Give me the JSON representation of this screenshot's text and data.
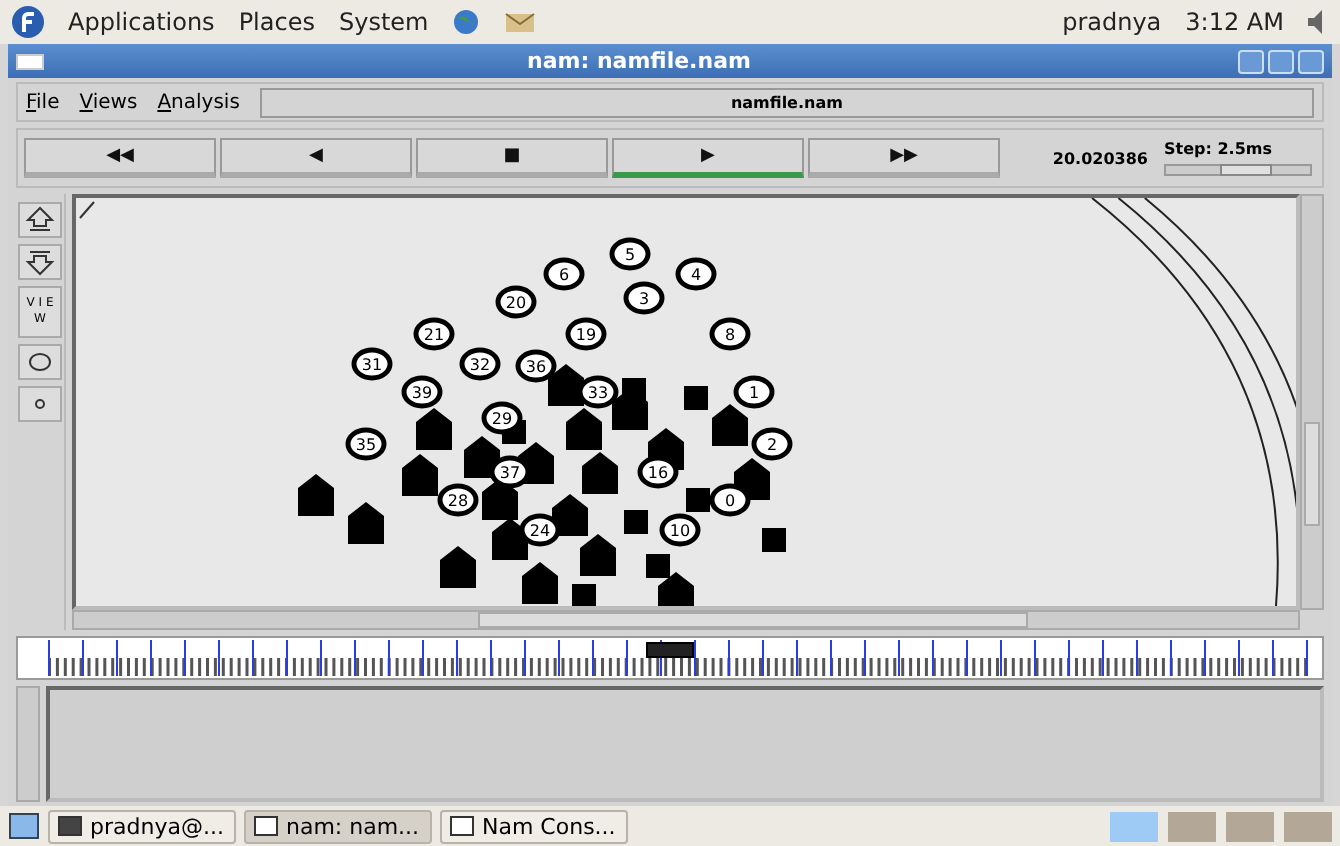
{
  "top_panel": {
    "menus": [
      "Applications",
      "Places",
      "System"
    ],
    "user": "pradnya",
    "clock": "3:12 AM"
  },
  "window": {
    "title": "nam: namfile.nam"
  },
  "menu_bar": {
    "items": [
      "File",
      "Views",
      "Analysis"
    ],
    "file_label": "namfile.nam"
  },
  "playback": {
    "buttons": [
      {
        "symbol": "◀◀",
        "selected": false
      },
      {
        "symbol": "◀",
        "selected": false
      },
      {
        "symbol": "■",
        "selected": false
      },
      {
        "symbol": "▶",
        "selected": true
      },
      {
        "symbol": "▶▶",
        "selected": false
      }
    ],
    "time": "20.020386",
    "step": "Step: 2.5ms",
    "step_slider": {
      "level": 0.55
    }
  },
  "tools": {
    "view_label": "V I E W"
  },
  "nodes": [
    {
      "label": "5"
    },
    {
      "label": "6"
    },
    {
      "label": "4"
    },
    {
      "label": "20"
    },
    {
      "label": "3"
    },
    {
      "label": "21"
    },
    {
      "label": "19"
    },
    {
      "label": "8"
    },
    {
      "label": "31"
    },
    {
      "label": "32"
    },
    {
      "label": "36"
    },
    {
      "label": "39"
    },
    {
      "label": "33"
    },
    {
      "label": "1"
    },
    {
      "label": "29"
    },
    {
      "label": "35"
    },
    {
      "label": "2"
    },
    {
      "label": "37"
    },
    {
      "label": "16"
    },
    {
      "label": "28"
    },
    {
      "label": "0"
    },
    {
      "label": "24"
    },
    {
      "label": "10"
    }
  ],
  "timeline": {
    "level": 0.5
  },
  "taskbar": {
    "tasks": [
      {
        "label": "pradnya@...",
        "selected": false
      },
      {
        "label": "nam: nam...",
        "selected": true
      },
      {
        "label": "Nam Cons...",
        "selected": false
      }
    ],
    "workspaces": [
      {
        "selected": true
      },
      {
        "selected": false
      },
      {
        "selected": false
      },
      {
        "selected": false
      }
    ]
  }
}
